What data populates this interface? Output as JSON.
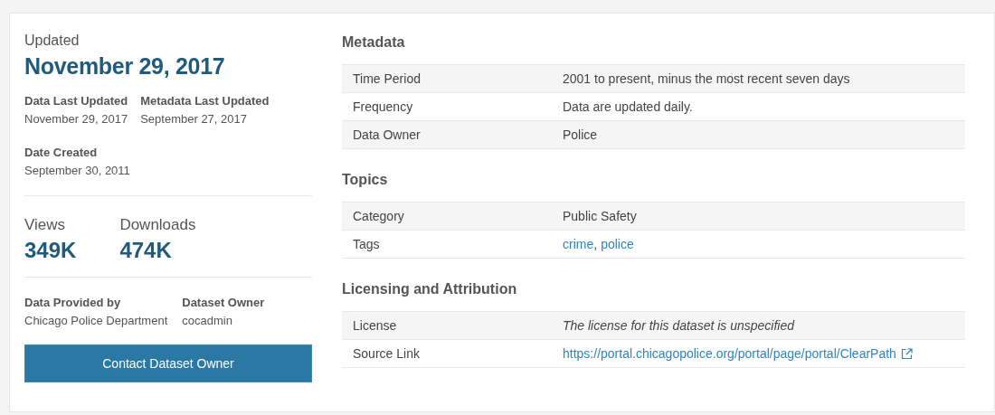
{
  "updated": {
    "label": "Updated",
    "date": "November 29, 2017"
  },
  "dates": [
    {
      "label": "Data Last Updated",
      "value": "November 29, 2017"
    },
    {
      "label": "Metadata Last Updated",
      "value": "September 27, 2017"
    }
  ],
  "date_created": {
    "label": "Date Created",
    "value": "September 30, 2011"
  },
  "stats": [
    {
      "label": "Views",
      "value": "349K"
    },
    {
      "label": "Downloads",
      "value": "474K"
    }
  ],
  "provider": [
    {
      "label": "Data Provided by",
      "value": "Chicago Police Department"
    },
    {
      "label": "Dataset Owner",
      "value": "cocadmin"
    }
  ],
  "contact_button": "Contact Dataset Owner",
  "sections": [
    {
      "title": "Metadata",
      "rows": [
        {
          "label": "Time Period",
          "kind": "text",
          "value": "2001 to present, minus the most recent seven days"
        },
        {
          "label": "Frequency",
          "kind": "text",
          "value": "Data are updated daily."
        },
        {
          "label": "Data Owner",
          "kind": "text",
          "value": "Police"
        }
      ]
    },
    {
      "title": "Topics",
      "rows": [
        {
          "label": "Category",
          "kind": "text",
          "value": "Public Safety"
        },
        {
          "label": "Tags",
          "kind": "tags",
          "tags": [
            "crime",
            "police"
          ],
          "separator": ","
        }
      ]
    },
    {
      "title": "Licensing and Attribution",
      "rows": [
        {
          "label": "License",
          "kind": "note",
          "value": "The license for this dataset is unspecified"
        },
        {
          "label": "Source Link",
          "kind": "link",
          "value": "https://portal.chicagopolice.org/portal/page/portal/ClearPath"
        }
      ]
    }
  ]
}
